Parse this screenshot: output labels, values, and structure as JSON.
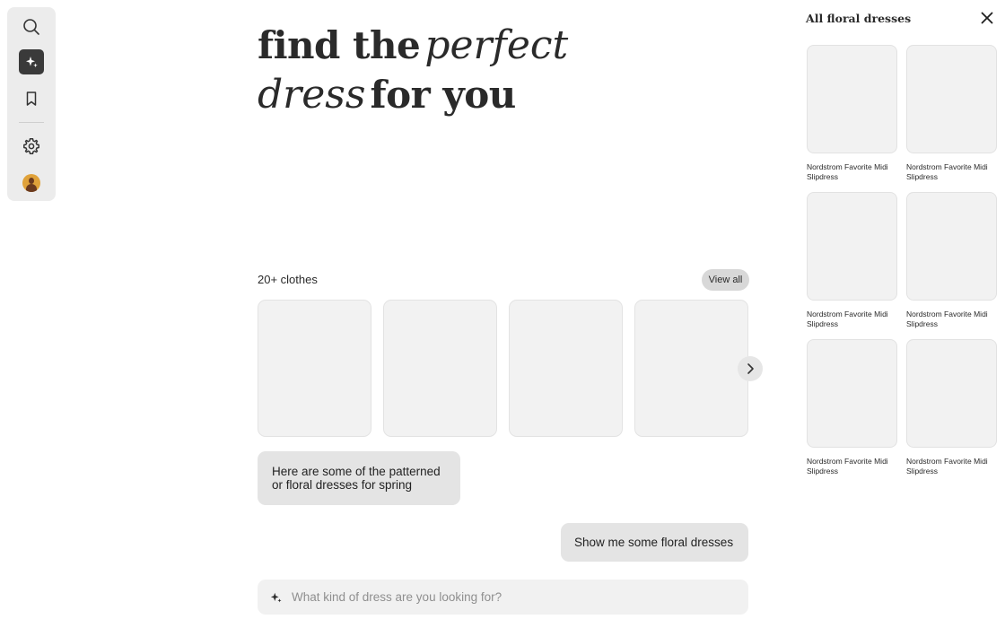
{
  "sidebar": {
    "search_icon": "search-icon",
    "ai_icon": "sparkle-icon",
    "saved_icon": "bookmark-icon",
    "settings_icon": "gear-icon",
    "active_color": "#3a3a3a"
  },
  "hero": {
    "line1_bold": "find the",
    "line1_italic": "perfect",
    "line2_italic": "dress",
    "line2_bold": "for you"
  },
  "results": {
    "count_label": "20+ clothes",
    "view_all_label": "View all",
    "cards": 4
  },
  "chat": {
    "assistant_message": "Here are some of the patterned or floral dresses for spring",
    "user_message": "Show me some floral dresses"
  },
  "input": {
    "placeholder": "What kind of dress are you looking for?"
  },
  "panel": {
    "title": "All floral dresses",
    "items": [
      {
        "label": "Nordstrom Favorite Midi Slipdress"
      },
      {
        "label": "Nordstrom Favorite Midi Slipdress"
      },
      {
        "label": "Nordstrom Favorite Midi Slipdress"
      },
      {
        "label": "Nordstrom Favorite Midi Slipdress"
      },
      {
        "label": "Nordstrom Favorite Midi Slipdress"
      },
      {
        "label": "Nordstrom Favorite Midi Slipdress"
      }
    ]
  }
}
